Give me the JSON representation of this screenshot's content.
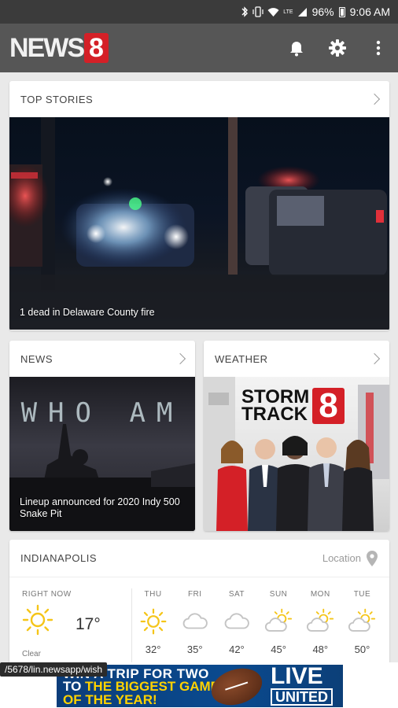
{
  "status_bar": {
    "battery": "96%",
    "time": "9:06 AM",
    "icons": [
      "bluetooth-icon",
      "vibrate-icon",
      "wifi-icon",
      "lte-icon",
      "signal-icon",
      "battery-icon"
    ]
  },
  "app_bar": {
    "logo_word": "NEWS",
    "logo_number": "8",
    "actions": [
      "bell-icon",
      "gear-icon",
      "more-vert-icon"
    ]
  },
  "top_stories": {
    "title": "TOP STORIES",
    "caption": "1 dead in Delaware County fire"
  },
  "news": {
    "title": "NEWS",
    "image_text": "WHO AM",
    "caption_line1": "Lineup announced for 2020 Indy 500",
    "caption_line2": "Snake Pit"
  },
  "weather": {
    "title": "WEATHER",
    "logo_line1": "STORM",
    "logo_line2": "TRACK",
    "logo_number": "8"
  },
  "forecast": {
    "city": "INDIANAPOLIS",
    "location_label": "Location",
    "now": {
      "label": "RIGHT NOW",
      "temp": "17°",
      "condition": "Clear",
      "icon": "sun-icon"
    },
    "days": [
      {
        "name": "THU",
        "temp": "32°",
        "icon": "sun-icon"
      },
      {
        "name": "FRI",
        "temp": "35°",
        "icon": "cloud-icon"
      },
      {
        "name": "SAT",
        "temp": "42°",
        "icon": "cloud-icon"
      },
      {
        "name": "SUN",
        "temp": "45°",
        "icon": "partly-cloudy-icon"
      },
      {
        "name": "MON",
        "temp": "48°",
        "icon": "partly-cloudy-icon"
      },
      {
        "name": "TUE",
        "temp": "50°",
        "icon": "partly-cloudy-icon"
      }
    ]
  },
  "url_overlay": "/5678/lin.newsapp/wish",
  "ad": {
    "line1": "WIN A TRIP FOR TWO",
    "line2_prefix": "TO",
    "line2": "THE BIGGEST GAME",
    "line3": "OF THE YEAR!",
    "brand_top": "LIVE",
    "brand_bottom": "UNITED"
  },
  "colors": {
    "brand_red": "#d42027",
    "app_bar": "#565656",
    "sun": "#f5c518",
    "ad_blue": "#0a4a8f"
  }
}
